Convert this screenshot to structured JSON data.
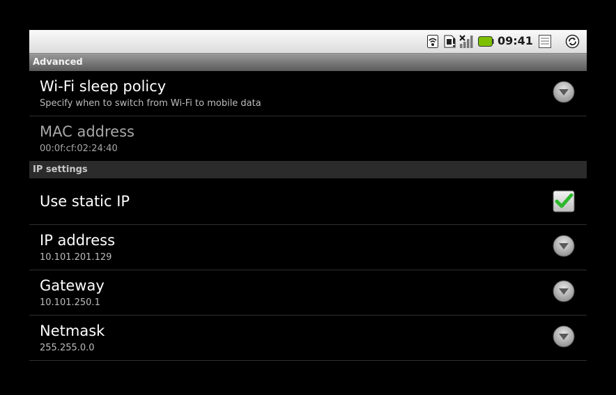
{
  "status_bar": {
    "time": "09:41",
    "icons": [
      "wifi-icon",
      "sim-card-icon",
      "no-signal-icon",
      "battery-icon",
      "notes-icon",
      "sync-icon"
    ],
    "battery_color": "#7cc000"
  },
  "sections": {
    "advanced": "Advanced",
    "ip_settings": "IP settings"
  },
  "rows": {
    "sleep_policy": {
      "title": "Wi-Fi sleep policy",
      "summary": "Specify when to switch from Wi-Fi to mobile data"
    },
    "mac_address": {
      "title": "MAC address",
      "summary": "00:0f:cf:02:24:40"
    },
    "static_ip": {
      "title": "Use static IP",
      "checked": true
    },
    "ip_address": {
      "title": "IP address",
      "summary": "10.101.201.129"
    },
    "gateway": {
      "title": "Gateway",
      "summary": "10.101.250.1"
    },
    "netmask": {
      "title": "Netmask",
      "summary": "255.255.0.0"
    }
  },
  "colors": {
    "checkmark": "#2db82d",
    "divider": "#2f2f2f"
  }
}
